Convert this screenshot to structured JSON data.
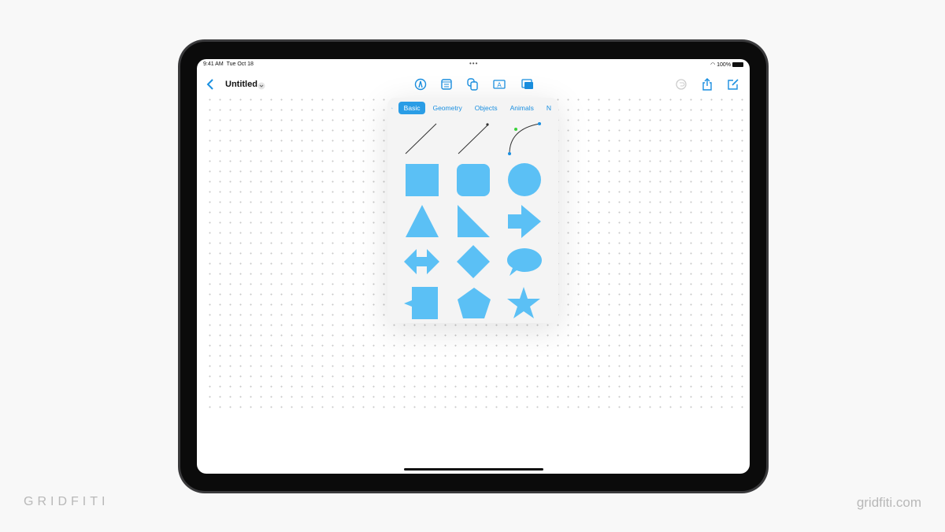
{
  "status": {
    "time": "9:41 AM",
    "date": "Tue Oct 18",
    "battery": "100%"
  },
  "toolbar": {
    "title": "Untitled",
    "icons": [
      "back-chevron-icon",
      "title-menu-chevron-icon",
      "pen-icon",
      "sticky-note-icon",
      "shapes-icon",
      "text-box-icon",
      "media-icon",
      "undo-icon",
      "share-icon",
      "compose-icon"
    ]
  },
  "shapes_popover": {
    "tabs": [
      {
        "label": "Basic",
        "active": true
      },
      {
        "label": "Geometry"
      },
      {
        "label": "Objects"
      },
      {
        "label": "Animals"
      },
      {
        "label": "N"
      }
    ],
    "shapes": [
      "line",
      "arrow-line",
      "curve",
      "square",
      "rounded-square",
      "circle",
      "triangle",
      "right-triangle",
      "arrow",
      "double-arrow",
      "diamond",
      "speech-bubble",
      "callout-square",
      "pentagon",
      "star"
    ],
    "shape_color": "#5bc0f5"
  },
  "watermark": {
    "left": "GRIDFITI",
    "right": "gridfiti.com"
  },
  "colors": {
    "accent": "#1a8fe0",
    "background": "#f8f8f8"
  }
}
